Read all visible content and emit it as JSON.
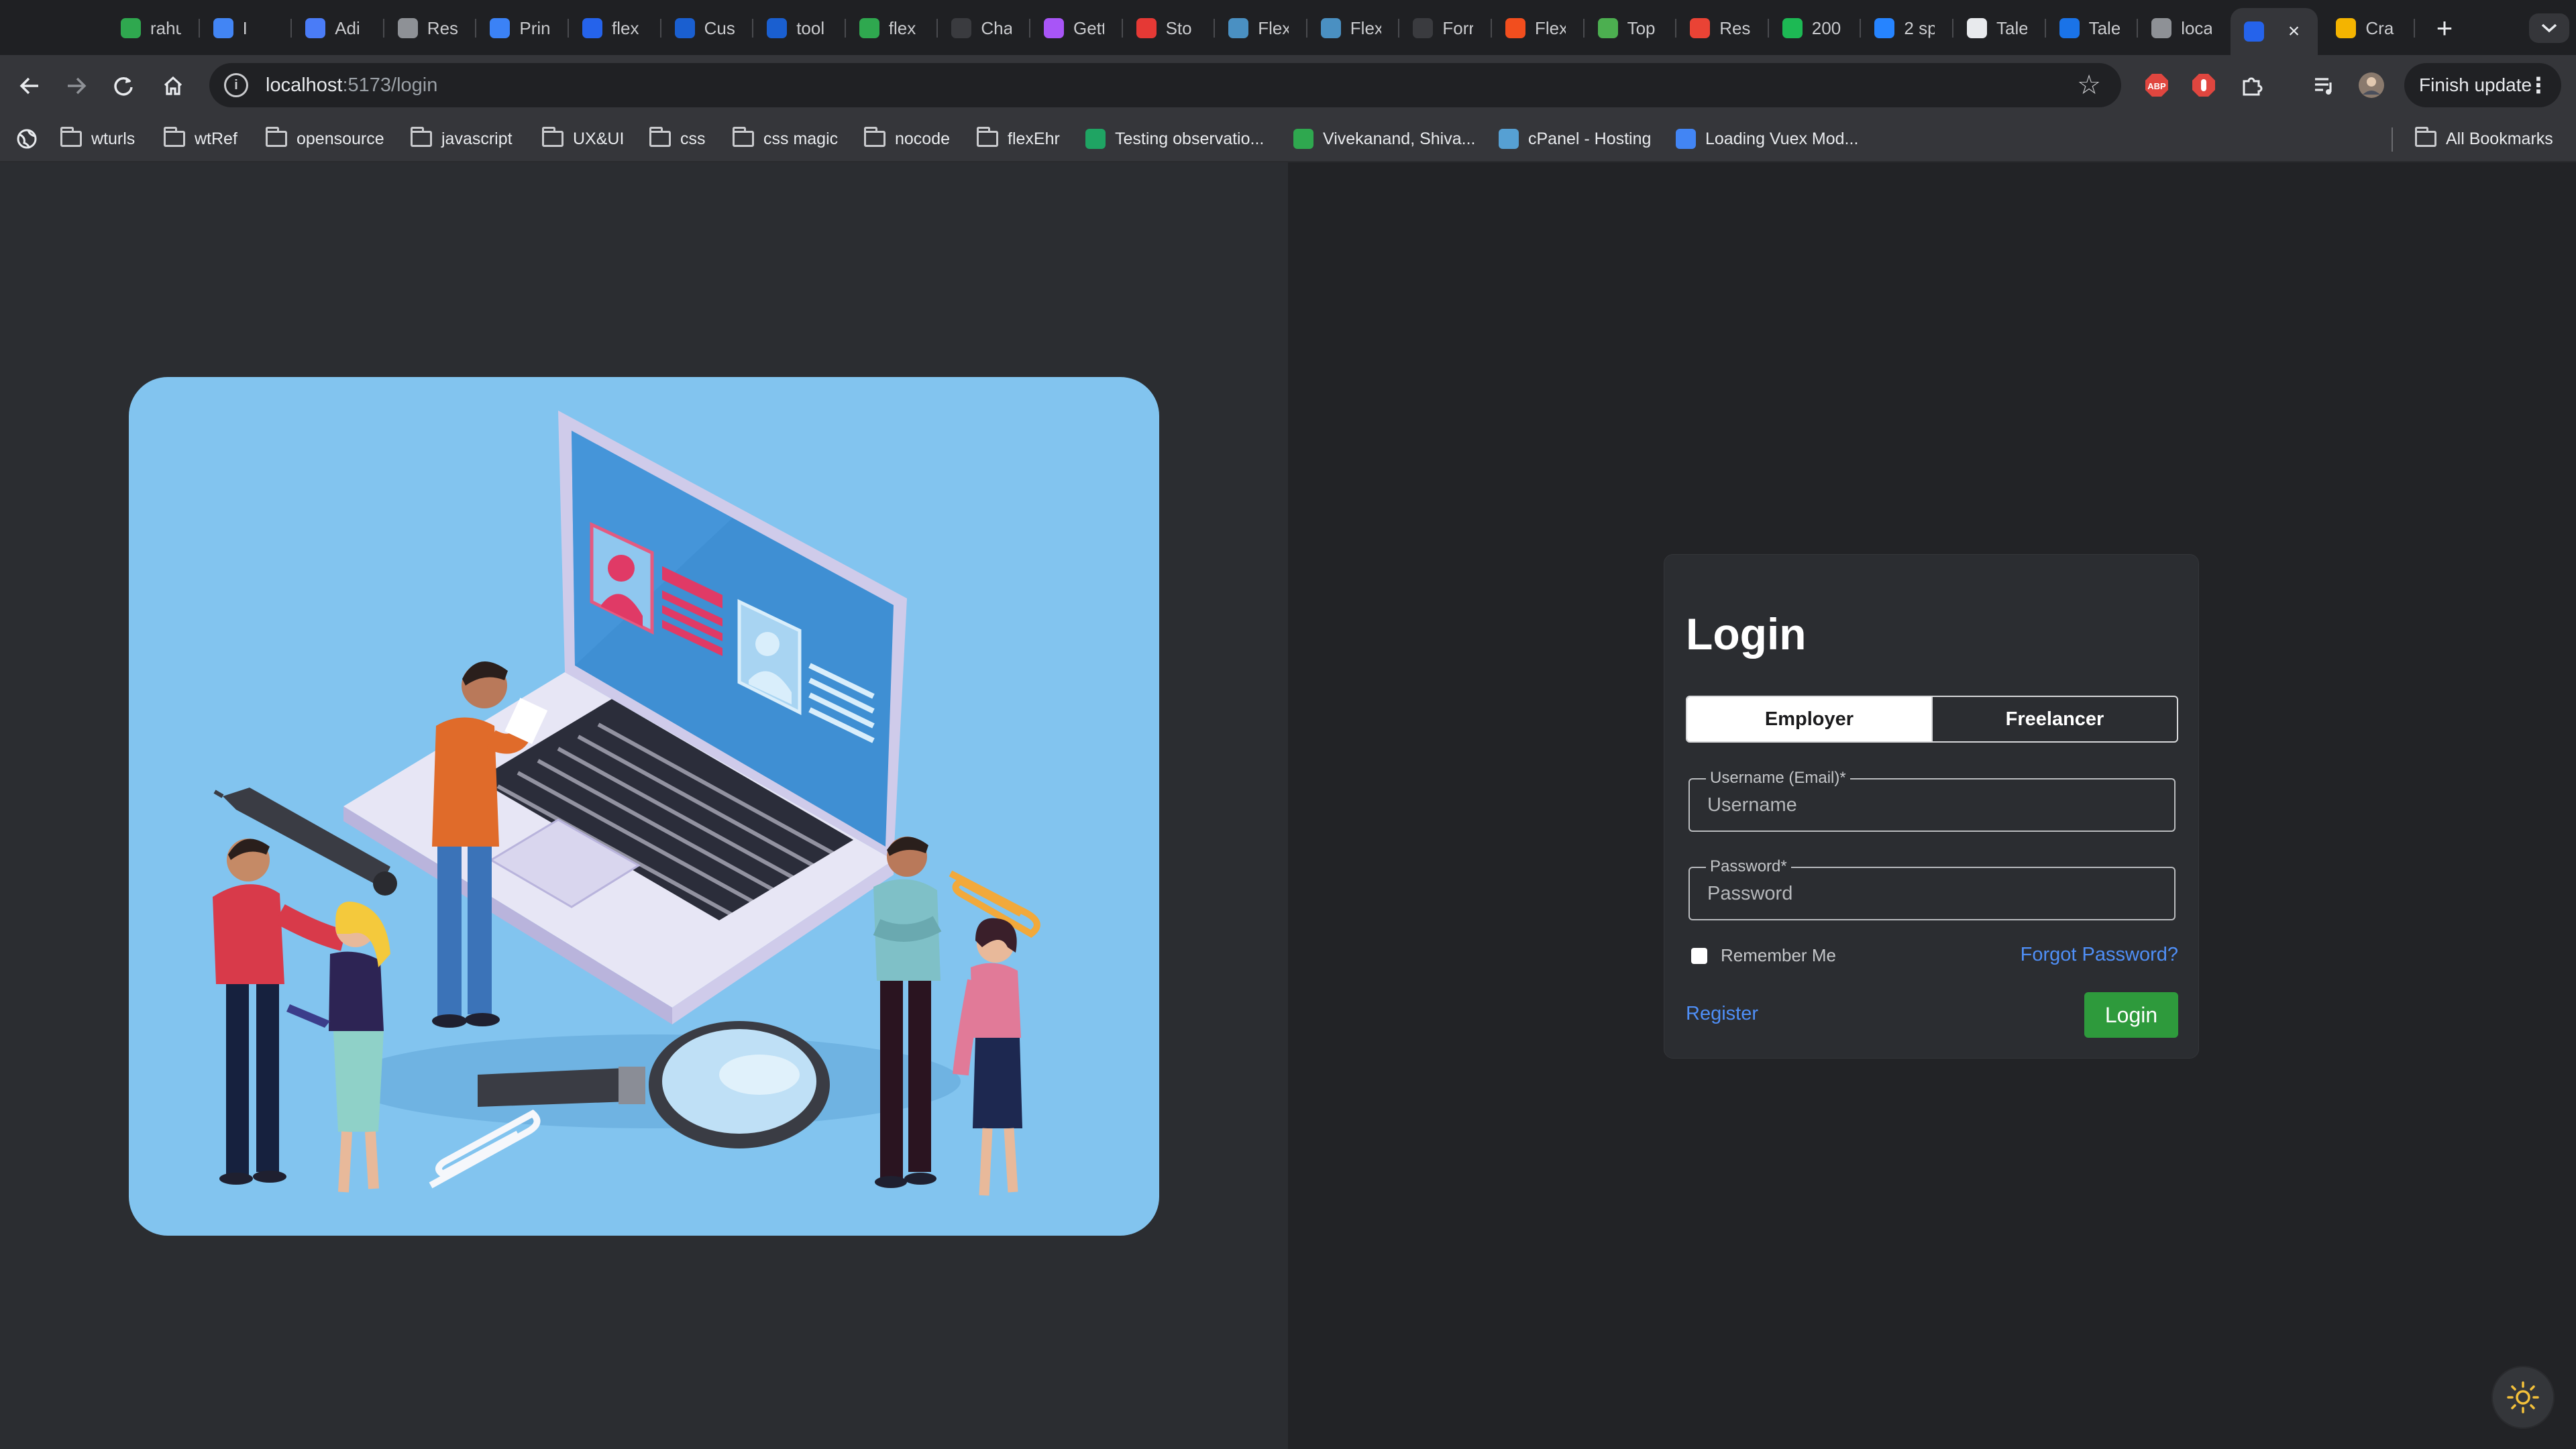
{
  "browser": {
    "tabs": [
      {
        "title": "rahu",
        "color": "#2fa84f"
      },
      {
        "title": "I",
        "color": "#4285f4"
      },
      {
        "title": "Adi",
        "color": "#4a7cf7"
      },
      {
        "title": "Res",
        "color": "#8e9196"
      },
      {
        "title": "Prin",
        "color": "#3b82f6"
      },
      {
        "title": "flex",
        "color": "#2563eb"
      },
      {
        "title": "Cus",
        "color": "#1a5fd0"
      },
      {
        "title": "tool",
        "color": "#1a5fd0"
      },
      {
        "title": "flex",
        "color": "#2fa84f"
      },
      {
        "title": "Cha",
        "color": "#3a3b3f"
      },
      {
        "title": "Gett",
        "color": "#a855f7"
      },
      {
        "title": "Sto",
        "color": "#e53935"
      },
      {
        "title": "Flex",
        "color": "#4a90c2"
      },
      {
        "title": "Flex",
        "color": "#4a90c2"
      },
      {
        "title": "Forr",
        "color": "#3a3b3f"
      },
      {
        "title": "Flex",
        "color": "#f24e1e"
      },
      {
        "title": "Top",
        "color": "#4caf50"
      },
      {
        "title": "Res",
        "color": "#ea4335"
      },
      {
        "title": "200",
        "color": "#1db954"
      },
      {
        "title": "2 sp",
        "color": "#2684ff"
      },
      {
        "title": "Tale",
        "color": "#e8eaed"
      },
      {
        "title": "Tale",
        "color": "#1a73e8"
      },
      {
        "title": "loca",
        "color": "#8e9196"
      },
      {
        "title": "",
        "color": "#2563eb"
      },
      {
        "title": "Cra",
        "color": "#f4b400"
      }
    ],
    "new_tab_label": "+",
    "url_host": "localhost",
    "url_rest": ":5173/login",
    "finish_update_label": "Finish update",
    "bookmarks": [
      {
        "label": "wturls",
        "type": "folder"
      },
      {
        "label": "wtRef",
        "type": "folder"
      },
      {
        "label": "opensource",
        "type": "folder"
      },
      {
        "label": "javascript",
        "type": "folder"
      },
      {
        "label": "UX&UI",
        "type": "folder"
      },
      {
        "label": "css",
        "type": "folder"
      },
      {
        "label": "css magic",
        "type": "folder"
      },
      {
        "label": "nocode",
        "type": "folder"
      },
      {
        "label": "flexEhr",
        "type": "folder"
      },
      {
        "label": "Testing observatio...",
        "type": "site",
        "color": "#1fa463"
      },
      {
        "label": "Vivekanand, Shiva...",
        "type": "site",
        "color": "#2fa84f"
      },
      {
        "label": "cPanel - Hosting",
        "type": "site",
        "color": "#56a0d3"
      },
      {
        "label": "Loading Vuex Mod...",
        "type": "site",
        "color": "#4285f4"
      }
    ],
    "all_bookmarks_label": "All Bookmarks"
  },
  "login": {
    "title": "Login",
    "roles": [
      "Employer",
      "Freelancer"
    ],
    "active_role": "Employer",
    "username_label": "Username (Email)*",
    "username_placeholder": "Username",
    "username_value": "",
    "password_label": "Password*",
    "password_placeholder": "Password",
    "password_value": "",
    "remember_label": "Remember Me",
    "forgot_label": "Forgot Password?",
    "register_label": "Register",
    "submit_label": "Login"
  },
  "colors": {
    "illustration_bg": "#82c4ef",
    "accent_link": "#4f8ff7",
    "login_button": "#2e9a3c"
  }
}
